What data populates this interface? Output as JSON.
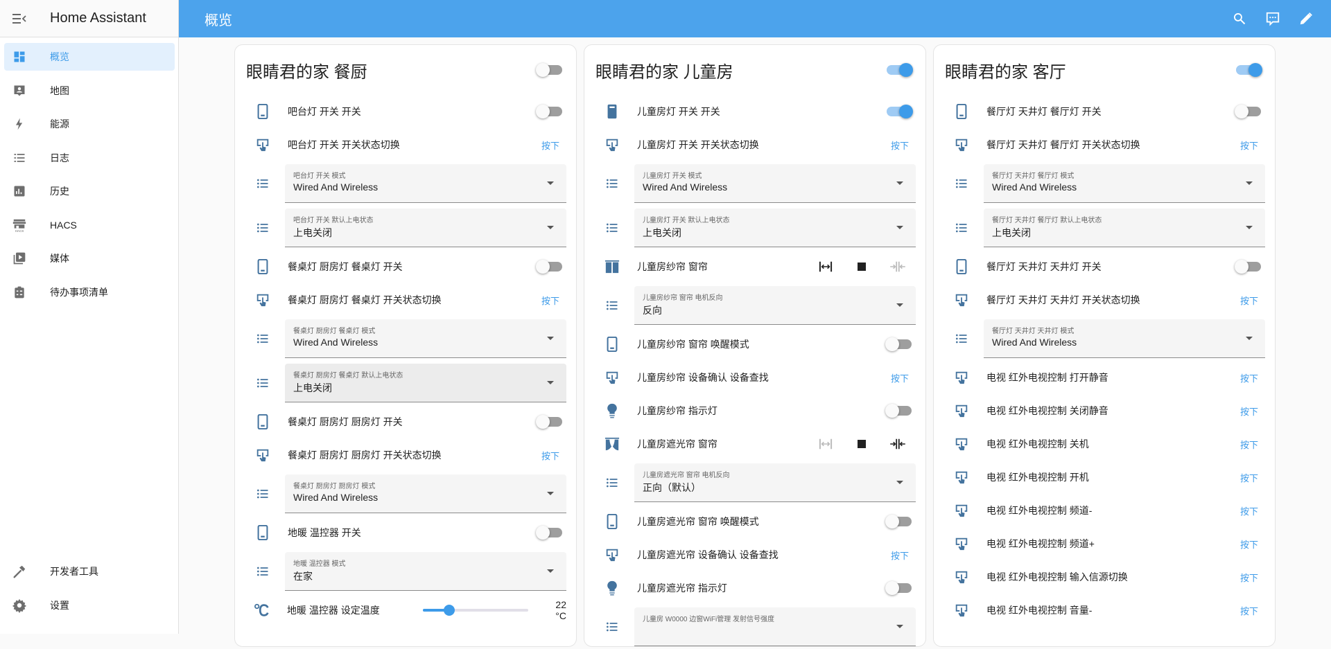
{
  "app": {
    "title": "Home Assistant"
  },
  "sidebar": {
    "items": [
      {
        "label": "概览",
        "icon": "dashboard-icon",
        "active": true
      },
      {
        "label": "地图",
        "icon": "map-account-icon"
      },
      {
        "label": "能源",
        "icon": "lightning-bolt-icon"
      },
      {
        "label": "日志",
        "icon": "logbook-list-icon"
      },
      {
        "label": "历史",
        "icon": "chart-box-icon"
      },
      {
        "label": "HACS",
        "icon": "hacs-icon"
      },
      {
        "label": "媒体",
        "icon": "media-play-icon"
      },
      {
        "label": "待办事项清单",
        "icon": "clipboard-list-icon"
      }
    ],
    "bottom_items": [
      {
        "label": "开发者工具",
        "icon": "hammer-icon"
      },
      {
        "label": "设置",
        "icon": "gear-icon"
      }
    ]
  },
  "header": {
    "title": "概览",
    "icons": [
      "search-icon",
      "assist-chat-icon",
      "pencil-icon"
    ]
  },
  "colors": {
    "accent": "#4ca3ec",
    "entity_icon": "#44739e",
    "press_link": "#3d9be9"
  },
  "cards": [
    {
      "title": "眼睛君的家 餐厨",
      "toggle_on": false,
      "rows": [
        {
          "type": "switch",
          "icon": "cellphone-icon",
          "name": "吧台灯 开关 开关",
          "on": false
        },
        {
          "type": "button",
          "icon": "gesture-tap-button-icon",
          "name": "吧台灯 开关 开关状态切换",
          "action": "按下"
        },
        {
          "type": "select",
          "icon": "format-list-bulleted-icon",
          "label": "吧台灯 开关 模式",
          "value": "Wired And Wireless"
        },
        {
          "type": "select",
          "icon": "format-list-bulleted-icon",
          "label": "吧台灯 开关 默认上电状态",
          "value": "上电关闭"
        },
        {
          "type": "switch",
          "icon": "cellphone-icon",
          "name": "餐桌灯 厨房灯 餐桌灯 开关",
          "on": false
        },
        {
          "type": "button",
          "icon": "gesture-tap-button-icon",
          "name": "餐桌灯 厨房灯 餐桌灯 开关状态切换",
          "action": "按下"
        },
        {
          "type": "select",
          "icon": "format-list-bulleted-icon",
          "label": "餐桌灯 厨房灯 餐桌灯 模式",
          "value": "Wired And Wireless"
        },
        {
          "type": "select",
          "icon": "format-list-bulleted-icon",
          "label": "餐桌灯 厨房灯 餐桌灯 默认上电状态",
          "value": "上电关闭",
          "hover": true
        },
        {
          "type": "switch",
          "icon": "cellphone-icon",
          "name": "餐桌灯 厨房灯 厨房灯 开关",
          "on": false
        },
        {
          "type": "button",
          "icon": "gesture-tap-button-icon",
          "name": "餐桌灯 厨房灯 厨房灯 开关状态切换",
          "action": "按下"
        },
        {
          "type": "select",
          "icon": "format-list-bulleted-icon",
          "label": "餐桌灯 厨房灯 厨房灯 模式",
          "value": "Wired And Wireless"
        },
        {
          "type": "switch",
          "icon": "cellphone-icon",
          "name": "地暖 温控器 开关",
          "on": false
        },
        {
          "type": "select",
          "icon": "format-list-bulleted-icon",
          "label": "地暖 温控器 模式",
          "value": "在家"
        },
        {
          "type": "slider",
          "icon": "temperature-celsius-icon",
          "name": "地暖 温控器 设定温度",
          "value_text": "22 °C",
          "fraction": 0.25
        }
      ]
    },
    {
      "title": "眼睛君的家 儿童房",
      "toggle_on": true,
      "rows": [
        {
          "type": "switch",
          "icon": "cellphone-on-icon",
          "name": "儿童房灯 开关 开关",
          "on": true
        },
        {
          "type": "button",
          "icon": "gesture-tap-button-icon",
          "name": "儿童房灯 开关 开关状态切换",
          "action": "按下"
        },
        {
          "type": "select",
          "icon": "format-list-bulleted-icon",
          "label": "儿童房灯 开关 模式",
          "value": "Wired And Wireless"
        },
        {
          "type": "select",
          "icon": "format-list-bulleted-icon",
          "label": "儿童房灯 开关 默认上电状态",
          "value": "上电关闭"
        },
        {
          "type": "cover",
          "icon": "curtains-open-icon",
          "name": "儿童房纱帘 窗帘",
          "open_disabled": false,
          "close_disabled": true
        },
        {
          "type": "select",
          "icon": "format-list-bulleted-icon",
          "label": "儿童房纱帘 窗帘 电机反向",
          "value": "反向"
        },
        {
          "type": "switch",
          "icon": "cellphone-icon",
          "name": "儿童房纱帘 窗帘 唤醒模式",
          "on": false
        },
        {
          "type": "button",
          "icon": "gesture-tap-button-icon",
          "name": "儿童房纱帘 设备确认 设备查找",
          "action": "按下"
        },
        {
          "type": "switch",
          "icon": "lightbulb-icon",
          "name": "儿童房纱帘 指示灯",
          "on": false
        },
        {
          "type": "cover",
          "icon": "curtains-closed-icon",
          "name": "儿童房遮光帘 窗帘",
          "open_disabled": true,
          "close_disabled": false
        },
        {
          "type": "select",
          "icon": "format-list-bulleted-icon",
          "label": "儿童房遮光帘 窗帘 电机反向",
          "value": "正向（默认）"
        },
        {
          "type": "switch",
          "icon": "cellphone-icon",
          "name": "儿童房遮光帘 窗帘 唤醒模式",
          "on": false
        },
        {
          "type": "button",
          "icon": "gesture-tap-button-icon",
          "name": "儿童房遮光帘 设备确认 设备查找",
          "action": "按下"
        },
        {
          "type": "switch",
          "icon": "lightbulb-icon",
          "name": "儿童房遮光帘 指示灯",
          "on": false
        },
        {
          "type": "select",
          "icon": "format-list-bulleted-icon",
          "label": "儿童房 W0000 边窗WiFi管理 发射信号强度",
          "value": ""
        }
      ]
    },
    {
      "title": "眼睛君的家 客厅",
      "toggle_on": true,
      "rows": [
        {
          "type": "switch",
          "icon": "cellphone-icon",
          "name": "餐厅灯 天井灯 餐厅灯 开关",
          "on": false
        },
        {
          "type": "button",
          "icon": "gesture-tap-button-icon",
          "name": "餐厅灯 天井灯 餐厅灯 开关状态切换",
          "action": "按下"
        },
        {
          "type": "select",
          "icon": "format-list-bulleted-icon",
          "label": "餐厅灯 天井灯 餐厅灯 模式",
          "value": "Wired And Wireless"
        },
        {
          "type": "select",
          "icon": "format-list-bulleted-icon",
          "label": "餐厅灯 天井灯 餐厅灯 默认上电状态",
          "value": "上电关闭"
        },
        {
          "type": "switch",
          "icon": "cellphone-icon",
          "name": "餐厅灯 天井灯 天井灯 开关",
          "on": false
        },
        {
          "type": "button",
          "icon": "gesture-tap-button-icon",
          "name": "餐厅灯 天井灯 天井灯 开关状态切换",
          "action": "按下"
        },
        {
          "type": "select",
          "icon": "format-list-bulleted-icon",
          "label": "餐厅灯 天井灯 天井灯 模式",
          "value": "Wired And Wireless"
        },
        {
          "type": "button",
          "icon": "gesture-tap-button-icon",
          "name": "电视 红外电视控制 打开静音",
          "action": "按下"
        },
        {
          "type": "button",
          "icon": "gesture-tap-button-icon",
          "name": "电视 红外电视控制 关闭静音",
          "action": "按下"
        },
        {
          "type": "button",
          "icon": "gesture-tap-button-icon",
          "name": "电视 红外电视控制 关机",
          "action": "按下"
        },
        {
          "type": "button",
          "icon": "gesture-tap-button-icon",
          "name": "电视 红外电视控制 开机",
          "action": "按下"
        },
        {
          "type": "button",
          "icon": "gesture-tap-button-icon",
          "name": "电视 红外电视控制 频道-",
          "action": "按下"
        },
        {
          "type": "button",
          "icon": "gesture-tap-button-icon",
          "name": "电视 红外电视控制 频道+",
          "action": "按下"
        },
        {
          "type": "button",
          "icon": "gesture-tap-button-icon",
          "name": "电视 红外电视控制 输入信源切换",
          "action": "按下"
        },
        {
          "type": "button",
          "icon": "gesture-tap-button-icon",
          "name": "电视 红外电视控制 音量-",
          "action": "按下"
        }
      ]
    }
  ]
}
